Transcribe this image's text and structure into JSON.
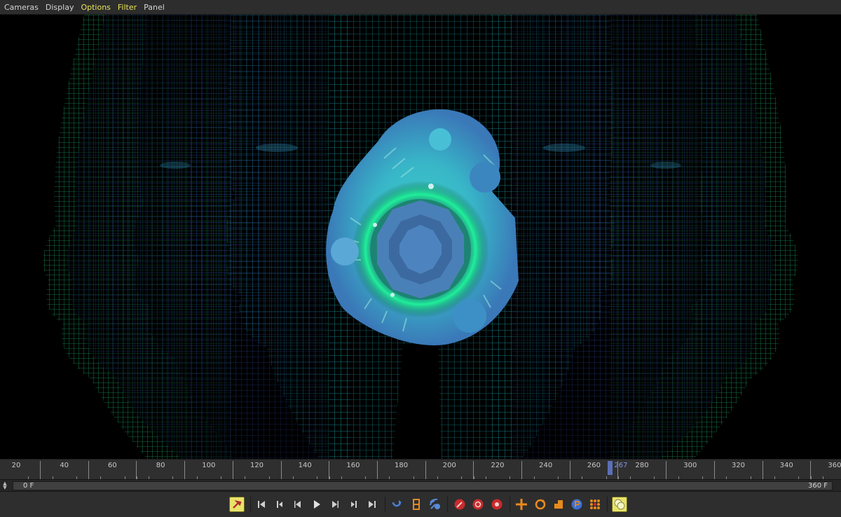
{
  "menu": {
    "items": [
      {
        "label": "Cameras",
        "active": false
      },
      {
        "label": "Display",
        "active": false
      },
      {
        "label": "Options",
        "active": true
      },
      {
        "label": "Filter",
        "active": true
      },
      {
        "label": "Panel",
        "active": false
      }
    ]
  },
  "timeline": {
    "ticks": [
      "20",
      "40",
      "60",
      "80",
      "100",
      "120",
      "140",
      "160",
      "180",
      "200",
      "220",
      "240",
      "260",
      "280",
      "300",
      "320",
      "340",
      "360"
    ],
    "current_frame": "267",
    "current_frame_value": 267,
    "range_start": "0 F",
    "range_end": "360 F"
  },
  "colors": {
    "accent_active": "#e8e35a",
    "playhead": "#5b6fb8",
    "wire_cyan": "#1fc7b8",
    "wire_blue": "#2e52a8",
    "wire_green": "#1fb86a",
    "record": "#c92b2b",
    "orange": "#e88a1c",
    "key_blue": "#3b6fd1"
  },
  "transport": {
    "icons": [
      "pointer-icon",
      "goto-start-icon",
      "prev-key-icon",
      "step-back-icon",
      "play-icon",
      "step-forward-icon",
      "next-key-icon",
      "goto-end-icon",
      "loop-icon",
      "film-icon",
      "antenna-icon",
      "record-key-icon",
      "autokey-icon",
      "gear-key-icon",
      "move-key-icon",
      "rotate-key-icon",
      "scale-key-icon",
      "param-key-icon",
      "point-level-icon",
      "motion-icon"
    ]
  }
}
